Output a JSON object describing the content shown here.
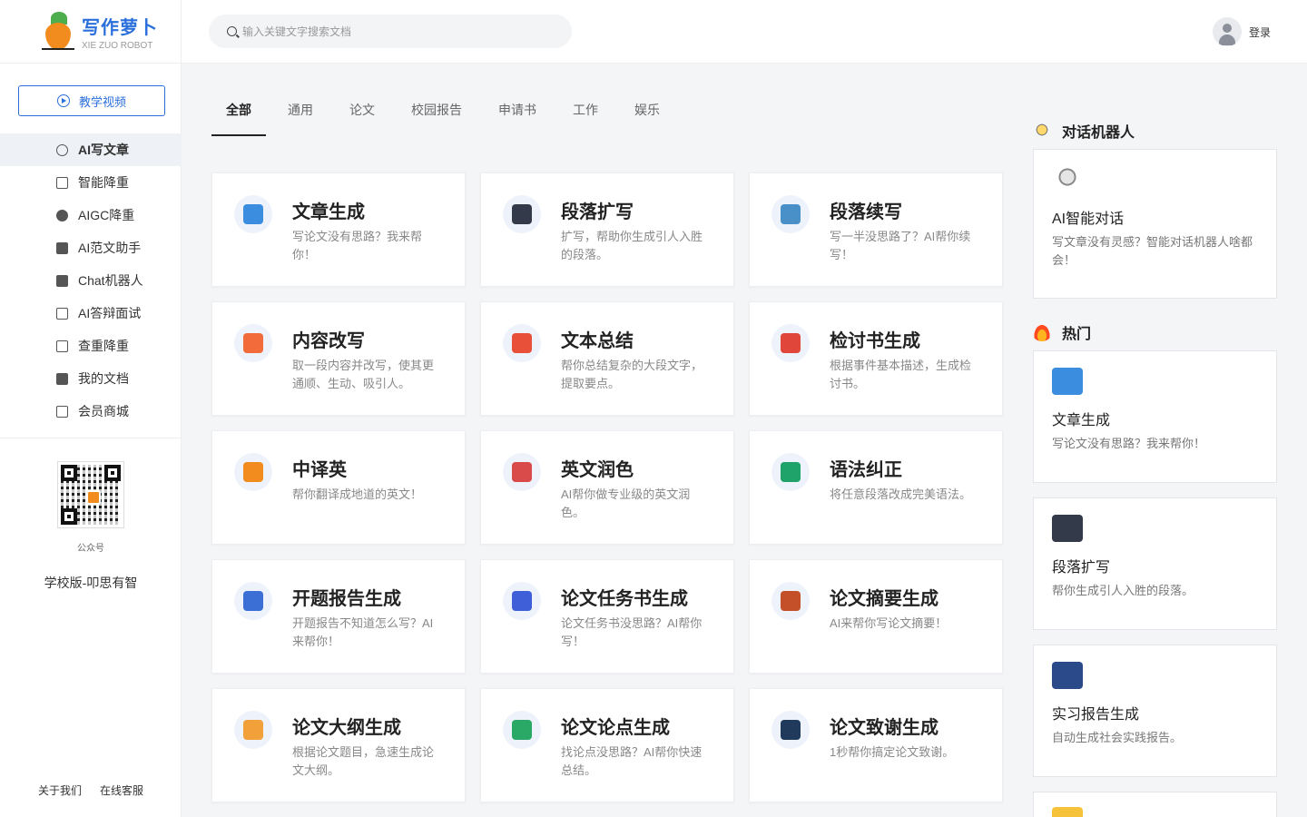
{
  "logo": {
    "title": "写作萝卜",
    "subtitle": "XIE ZUO ROBOT"
  },
  "sidebar": {
    "tutorial_label": "教学视频",
    "items": [
      {
        "label": "AI写文章",
        "icon": "ai-write-icon",
        "active": true
      },
      {
        "label": "智能降重",
        "icon": "reduce-icon"
      },
      {
        "label": "AIGC降重",
        "icon": "aigc-icon"
      },
      {
        "label": "AI范文助手",
        "icon": "sample-icon"
      },
      {
        "label": "Chat机器人",
        "icon": "robot-icon"
      },
      {
        "label": "AI答辩面试",
        "icon": "interview-icon"
      },
      {
        "label": "查重降重",
        "icon": "check-icon"
      },
      {
        "label": "我的文档",
        "icon": "folder-icon"
      },
      {
        "label": "会员商城",
        "icon": "shop-icon"
      }
    ],
    "qr_label": "公众号",
    "school": "学校版-叩思有智",
    "footer": {
      "about": "关于我们",
      "service": "在线客服"
    }
  },
  "header": {
    "search_placeholder": "输入关键文字搜索文档",
    "login": "登录"
  },
  "tabs": [
    "全部",
    "通用",
    "论文",
    "校园报告",
    "申请书",
    "工作",
    "娱乐"
  ],
  "cards": [
    {
      "title": "文章生成",
      "desc": "写论文没有思路？我来帮你！",
      "color": "#3b8de0"
    },
    {
      "title": "段落扩写",
      "desc": "扩写，帮助你生成引人入胜的段落。",
      "color": "#333a4a"
    },
    {
      "title": "段落续写",
      "desc": "写一半没思路了？AI帮你续写！",
      "color": "#4a90c8"
    },
    {
      "title": "内容改写",
      "desc": "取一段内容并改写，使其更通顺、生动、吸引人。",
      "color": "#f26b3a"
    },
    {
      "title": "文本总结",
      "desc": "帮你总结复杂的大段文字，提取要点。",
      "color": "#e8503a"
    },
    {
      "title": "检讨书生成",
      "desc": "根据事件基本描述，生成检讨书。",
      "color": "#e0473a"
    },
    {
      "title": "中译英",
      "desc": "帮你翻译成地道的英文！",
      "color": "#f28c1e"
    },
    {
      "title": "英文润色",
      "desc": "AI帮你做专业级的英文润色。",
      "color": "#d94a4a"
    },
    {
      "title": "语法纠正",
      "desc": "将任意段落改成完美语法。",
      "color": "#1fa36b"
    },
    {
      "title": "开题报告生成",
      "desc": "开题报告不知道怎么写？AI来帮你！",
      "color": "#3b6fd6"
    },
    {
      "title": "论文任务书生成",
      "desc": "论文任务书没思路？AI帮你写！",
      "color": "#3e5fd8"
    },
    {
      "title": "论文摘要生成",
      "desc": "AI来帮你写论文摘要！",
      "color": "#c4502a"
    },
    {
      "title": "论文大纲生成",
      "desc": "根据论文题目，急速生成论文大纲。",
      "color": "#f2a13a"
    },
    {
      "title": "论文论点生成",
      "desc": "找论点没思路？AI帮你快速总结。",
      "color": "#2aa866"
    },
    {
      "title": "论文致谢生成",
      "desc": "1秒帮你搞定论文致谢。",
      "color": "#1f3a5a"
    }
  ],
  "right": {
    "robot_section": "对话机器人",
    "robot_card": {
      "title": "AI智能对话",
      "desc": "写文章没有灵感？智能对话机器人啥都会！"
    },
    "hot_section": "热门",
    "hot_cards": [
      {
        "title": "文章生成",
        "desc": "写论文没有思路？我来帮你！",
        "color": "#3b8de0"
      },
      {
        "title": "段落扩写",
        "desc": "帮你生成引人入胜的段落。",
        "color": "#333a4a"
      },
      {
        "title": "实习报告生成",
        "desc": "自动生成社会实践报告。",
        "color": "#2a4a8a"
      }
    ]
  }
}
